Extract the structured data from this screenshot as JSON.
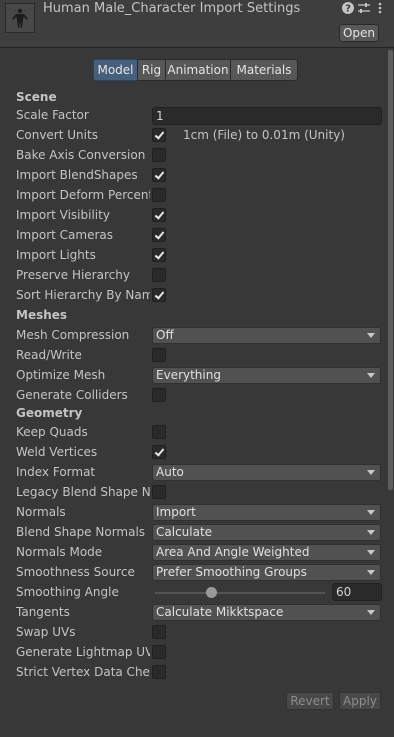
{
  "header": {
    "title": "Human Male_Character Import Settings",
    "open_label": "Open",
    "icons": [
      "help-icon",
      "preset-sliders-icon",
      "menu-dots-icon"
    ]
  },
  "tabs": [
    {
      "label": "Model",
      "active": true
    },
    {
      "label": "Rig",
      "active": false
    },
    {
      "label": "Animation",
      "active": false
    },
    {
      "label": "Materials",
      "active": false
    }
  ],
  "scene": {
    "heading": "Scene",
    "scale_factor": {
      "label": "Scale Factor",
      "value": "1"
    },
    "convert_units": {
      "label": "Convert Units",
      "checked": true,
      "note": "1cm (File) to 0.01m (Unity)"
    },
    "bake_axis": {
      "label": "Bake Axis Conversion",
      "checked": false
    },
    "import_blendshapes": {
      "label": "Import BlendShapes",
      "checked": true
    },
    "import_deform": {
      "label": "Import Deform Percent",
      "checked": false
    },
    "import_visibility": {
      "label": "Import Visibility",
      "checked": true
    },
    "import_cameras": {
      "label": "Import Cameras",
      "checked": true
    },
    "import_lights": {
      "label": "Import Lights",
      "checked": true
    },
    "preserve_hierarchy": {
      "label": "Preserve Hierarchy",
      "checked": false
    },
    "sort_hierarchy": {
      "label": "Sort Hierarchy By Name",
      "checked": true
    }
  },
  "meshes": {
    "heading": "Meshes",
    "mesh_compression": {
      "label": "Mesh Compression",
      "value": "Off"
    },
    "read_write": {
      "label": "Read/Write",
      "checked": false
    },
    "optimize_mesh": {
      "label": "Optimize Mesh",
      "value": "Everything"
    },
    "generate_colliders": {
      "label": "Generate Colliders",
      "checked": false
    }
  },
  "geometry": {
    "heading": "Geometry",
    "keep_quads": {
      "label": "Keep Quads",
      "checked": false
    },
    "weld_vertices": {
      "label": "Weld Vertices",
      "checked": true
    },
    "index_format": {
      "label": "Index Format",
      "value": "Auto"
    },
    "legacy_blend": {
      "label": "Legacy Blend Shape No",
      "checked": false
    },
    "normals": {
      "label": "Normals",
      "value": "Import"
    },
    "blend_shape_normals": {
      "label": "Blend Shape Normals",
      "value": "Calculate"
    },
    "normals_mode": {
      "label": "Normals Mode",
      "value": "Area And Angle Weighted"
    },
    "smoothness_source": {
      "label": "Smoothness Source",
      "value": "Prefer Smoothing Groups"
    },
    "smoothing_angle": {
      "label": "Smoothing Angle",
      "value": "60",
      "min": 0,
      "max": 180,
      "level": 60
    },
    "tangents": {
      "label": "Tangents",
      "value": "Calculate Mikktspace"
    },
    "swap_uvs": {
      "label": "Swap UVs",
      "checked": false
    },
    "generate_lightmap_uvs": {
      "label": "Generate Lightmap UVs",
      "checked": false
    },
    "strict_vertex": {
      "label": "Strict Vertex Data Checl",
      "checked": false
    }
  },
  "footer": {
    "revert_label": "Revert",
    "apply_label": "Apply"
  },
  "colors": {
    "background": "#383838",
    "active_tab": "#46607c"
  }
}
